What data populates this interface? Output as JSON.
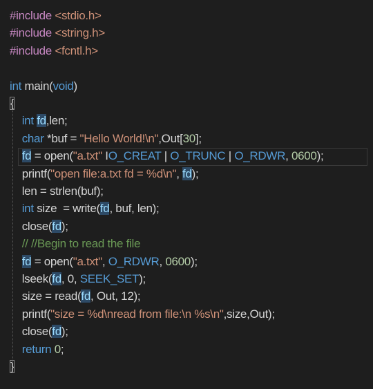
{
  "editor": {
    "colors": {
      "background": "#1e1e1e",
      "preprocessor": "#c586c0",
      "include_path": "#ce9178",
      "keyword": "#569cd6",
      "text": "#d4d4d4",
      "string": "#ce9178",
      "number": "#b5cea8",
      "macro": "#569cd6",
      "variable": "#9cdcfe",
      "comment": "#6a9955",
      "function": "#dcdcaa"
    },
    "lines": [
      [
        {
          "t": "#include ",
          "c": "preprocessor"
        },
        {
          "t": "<stdio.h>",
          "c": "include_path"
        }
      ],
      [
        {
          "t": "#include ",
          "c": "preprocessor"
        },
        {
          "t": "<string.h>",
          "c": "include_path"
        }
      ],
      [
        {
          "t": "#include ",
          "c": "preprocessor"
        },
        {
          "t": "<fcntl.h>",
          "c": "include_path"
        }
      ],
      [],
      [
        {
          "t": "int ",
          "c": "keyword"
        },
        {
          "t": "main(",
          "c": "text"
        },
        {
          "t": "void",
          "c": "keyword"
        },
        {
          "t": ")",
          "c": "text"
        }
      ],
      [
        {
          "t": "{",
          "c": "text",
          "box": true
        }
      ],
      [
        {
          "t": "    "
        },
        {
          "t": "int ",
          "c": "keyword"
        },
        {
          "t": "fd",
          "c": "variable",
          "hl": true
        },
        {
          "t": ",len;",
          "c": "text"
        }
      ],
      [
        {
          "t": "    "
        },
        {
          "t": "char ",
          "c": "keyword"
        },
        {
          "t": "*buf = ",
          "c": "text"
        },
        {
          "t": "\"Hello World!\\n\"",
          "c": "string"
        },
        {
          "t": ",Out[",
          "c": "text"
        },
        {
          "t": "30",
          "c": "number"
        },
        {
          "t": "];",
          "c": "text"
        }
      ],
      [
        {
          "t": "    "
        },
        {
          "t": "fd",
          "c": "variable",
          "hl": true
        },
        {
          "t": " = open(",
          "c": "text"
        },
        {
          "t": "\"a.txt\"",
          "c": "string"
        },
        {
          "t": " I",
          "c": "text"
        },
        {
          "t": "O_CREAT",
          "c": "macro"
        },
        {
          "t": " | ",
          "c": "text"
        },
        {
          "t": "O_TRUNC",
          "c": "macro"
        },
        {
          "t": " | ",
          "c": "text"
        },
        {
          "t": "O_RDWR",
          "c": "macro"
        },
        {
          "t": ", ",
          "c": "text"
        },
        {
          "t": "0600",
          "c": "number"
        },
        {
          "t": ");",
          "c": "text"
        }
      ],
      [
        {
          "t": "    "
        },
        {
          "t": "printf(",
          "c": "text"
        },
        {
          "t": "\"open file:a.txt fd = %d\\n\"",
          "c": "string"
        },
        {
          "t": ", ",
          "c": "text"
        },
        {
          "t": "fd",
          "c": "variable",
          "hl": true
        },
        {
          "t": ");",
          "c": "text"
        }
      ],
      [
        {
          "t": "    "
        },
        {
          "t": "len = strlen(buf);",
          "c": "text"
        }
      ],
      [
        {
          "t": "    "
        },
        {
          "t": "int ",
          "c": "keyword"
        },
        {
          "t": "size  = write(",
          "c": "text"
        },
        {
          "t": "fd",
          "c": "variable",
          "hl": true
        },
        {
          "t": ", buf, len);",
          "c": "text"
        }
      ],
      [
        {
          "t": "    "
        },
        {
          "t": "close(",
          "c": "text"
        },
        {
          "t": "fd",
          "c": "variable",
          "hl": true
        },
        {
          "t": ");",
          "c": "text"
        }
      ],
      [
        {
          "t": "    "
        },
        {
          "t": "// //Begin to read the file",
          "c": "comment"
        }
      ],
      [
        {
          "t": "    "
        },
        {
          "t": "fd",
          "c": "variable",
          "hl": true
        },
        {
          "t": " = open(",
          "c": "text"
        },
        {
          "t": "\"a.txt\"",
          "c": "string"
        },
        {
          "t": ", ",
          "c": "text"
        },
        {
          "t": "O_RDWR",
          "c": "macro"
        },
        {
          "t": ", ",
          "c": "text"
        },
        {
          "t": "0600",
          "c": "number"
        },
        {
          "t": ");",
          "c": "text"
        }
      ],
      [
        {
          "t": "    "
        },
        {
          "t": "lseek(",
          "c": "text"
        },
        {
          "t": "fd",
          "c": "variable",
          "hl": true
        },
        {
          "t": ", 0, ",
          "c": "text"
        },
        {
          "t": "SEEK_SET",
          "c": "macro"
        },
        {
          "t": ");",
          "c": "text"
        }
      ],
      [
        {
          "t": "    "
        },
        {
          "t": "size = read(",
          "c": "text"
        },
        {
          "t": "fd",
          "c": "variable",
          "hl": true
        },
        {
          "t": ", Out, 12);",
          "c": "text"
        }
      ],
      [
        {
          "t": "    "
        },
        {
          "t": "printf(",
          "c": "text"
        },
        {
          "t": "\"size = %d\\nread from file:\\n %s\\n\"",
          "c": "string"
        },
        {
          "t": ",size,Out);",
          "c": "text"
        }
      ],
      [
        {
          "t": "    "
        },
        {
          "t": "close(",
          "c": "text"
        },
        {
          "t": "fd",
          "c": "variable",
          "hl": true
        },
        {
          "t": ");",
          "c": "text"
        }
      ],
      [
        {
          "t": "    "
        },
        {
          "t": "return ",
          "c": "keyword"
        },
        {
          "t": "0",
          "c": "number"
        },
        {
          "t": ";",
          "c": "text"
        }
      ],
      [
        {
          "t": "}",
          "c": "text",
          "box": true
        }
      ]
    ]
  }
}
